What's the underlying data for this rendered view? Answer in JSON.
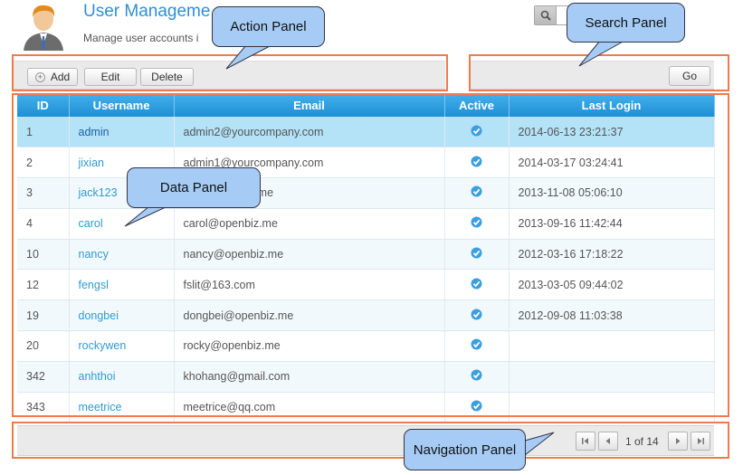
{
  "header": {
    "title": "User Manageme",
    "subtitle": "Manage user accounts i"
  },
  "toolbar": {
    "add_label": "Add",
    "edit_label": "Edit",
    "delete_label": "Delete"
  },
  "search": {
    "value": "",
    "go_label": "Go"
  },
  "table": {
    "columns": [
      "ID",
      "Username",
      "Email",
      "Active",
      "Last Login"
    ],
    "rows": [
      {
        "id": "1",
        "username": "admin",
        "email": "admin2@yourcompany.com",
        "active": true,
        "last_login": "2014-06-13 23:21:37"
      },
      {
        "id": "2",
        "username": "jixian",
        "email": "admin1@yourcompany.com",
        "active": true,
        "last_login": "2014-03-17 03:24:41"
      },
      {
        "id": "3",
        "username": "jack123",
        "email": "jack@openbiz.me",
        "active": true,
        "last_login": "2013-11-08 05:06:10"
      },
      {
        "id": "4",
        "username": "carol",
        "email": "carol@openbiz.me",
        "active": true,
        "last_login": "2013-09-16 11:42:44"
      },
      {
        "id": "10",
        "username": "nancy",
        "email": "nancy@openbiz.me",
        "active": true,
        "last_login": "2012-03-16 17:18:22"
      },
      {
        "id": "12",
        "username": "fengsl",
        "email": "fslit@163.com",
        "active": true,
        "last_login": "2013-03-05 09:44:02"
      },
      {
        "id": "19",
        "username": "dongbei",
        "email": "dongbei@openbiz.me",
        "active": true,
        "last_login": "2012-09-08 11:03:38"
      },
      {
        "id": "20",
        "username": "rockywen",
        "email": "rocky@openbiz.me",
        "active": true,
        "last_login": ""
      },
      {
        "id": "342",
        "username": "anhthoi",
        "email": "khohang@gmail.com",
        "active": true,
        "last_login": ""
      },
      {
        "id": "343",
        "username": "meetrice",
        "email": "meetrice@qq.com",
        "active": true,
        "last_login": ""
      }
    ],
    "selected_row": 0
  },
  "pager": {
    "page_text": "1 of 14"
  },
  "annotations": {
    "action_panel": "Action Panel",
    "search_panel": "Search Panel",
    "data_panel": "Data Panel",
    "navigation_panel": "Navigation Panel"
  },
  "colors": {
    "accent": "#2f8fd6",
    "header_bg": "#1f8fd3",
    "selected_row": "#b4e2f7",
    "annotation_border": "#f07a4a",
    "callout_bg": "#a6ccf6"
  }
}
